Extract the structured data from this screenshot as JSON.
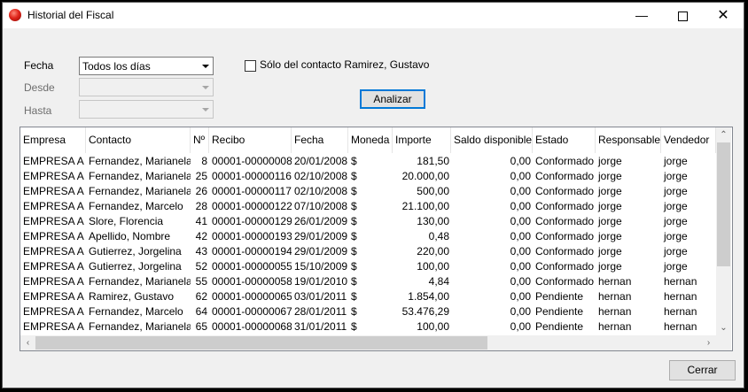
{
  "window": {
    "title": "Historial del Fiscal"
  },
  "filters": {
    "fecha_label": "Fecha",
    "fecha_value": "Todos los días",
    "desde_label": "Desde",
    "hasta_label": "Hasta",
    "contact_checkbox_label": "Sólo del contacto Ramirez, Gustavo",
    "contact_checkbox_checked": false
  },
  "buttons": {
    "analizar": "Analizar",
    "cerrar": "Cerrar"
  },
  "table": {
    "columns": [
      "Empresa",
      "Contacto",
      "Nº",
      "Recibo",
      "Fecha",
      "Moneda",
      "Importe",
      "Saldo disponible",
      "Estado",
      "Responsable",
      "Vendedor"
    ],
    "rows": [
      [
        "EMPRESA A",
        "Fernandez, Marianela",
        "8",
        "00001-00000008",
        "20/01/2008",
        "$",
        "181,50",
        "0,00",
        "Conformado",
        "jorge",
        "jorge"
      ],
      [
        "EMPRESA A",
        "Fernandez, Marianela",
        "25",
        "00001-00000116",
        "02/10/2008",
        "$",
        "20.000,00",
        "0,00",
        "Conformado",
        "jorge",
        "jorge"
      ],
      [
        "EMPRESA A",
        "Fernandez, Marianela",
        "26",
        "00001-00000117",
        "02/10/2008",
        "$",
        "500,00",
        "0,00",
        "Conformado",
        "jorge",
        "jorge"
      ],
      [
        "EMPRESA A",
        "Fernandez, Marcelo",
        "28",
        "00001-00000122",
        "07/10/2008",
        "$",
        "21.100,00",
        "0,00",
        "Conformado",
        "jorge",
        "jorge"
      ],
      [
        "EMPRESA A",
        "Slore, Florencia",
        "41",
        "00001-00000129",
        "26/01/2009",
        "$",
        "130,00",
        "0,00",
        "Conformado",
        "jorge",
        "jorge"
      ],
      [
        "EMPRESA A",
        "Apellido, Nombre",
        "42",
        "00001-00000193",
        "29/01/2009",
        "$",
        "0,48",
        "0,00",
        "Conformado",
        "jorge",
        "jorge"
      ],
      [
        "EMPRESA A",
        "Gutierrez, Jorgelina",
        "43",
        "00001-00000194",
        "29/01/2009",
        "$",
        "220,00",
        "0,00",
        "Conformado",
        "jorge",
        "jorge"
      ],
      [
        "EMPRESA A",
        "Gutierrez, Jorgelina",
        "52",
        "00001-00000055",
        "15/10/2009",
        "$",
        "100,00",
        "0,00",
        "Conformado",
        "jorge",
        "jorge"
      ],
      [
        "EMPRESA A",
        "Fernandez, Marianela",
        "55",
        "00001-00000058",
        "19/01/2010",
        "$",
        "4,84",
        "0,00",
        "Conformado",
        "hernan",
        "hernan"
      ],
      [
        "EMPRESA A",
        "Ramirez, Gustavo",
        "62",
        "00001-00000065",
        "03/01/2011",
        "$",
        "1.854,00",
        "0,00",
        "Pendiente",
        "hernan",
        "hernan"
      ],
      [
        "EMPRESA A",
        "Fernandez, Marcelo",
        "64",
        "00001-00000067",
        "28/01/2011",
        "$",
        "53.476,29",
        "0,00",
        "Pendiente",
        "hernan",
        "hernan"
      ],
      [
        "EMPRESA A",
        "Fernandez, Marianela",
        "65",
        "00001-00000068",
        "31/01/2011",
        "$",
        "100,00",
        "0,00",
        "Pendiente",
        "hernan",
        "hernan"
      ]
    ]
  },
  "colors": {
    "focus_border": "#0078d7",
    "grid_border": "#828790",
    "window_bg": "#f0f0f0"
  },
  "icons": {
    "app": "red-ball-icon",
    "minimize": "minimize-icon",
    "maximize": "maximize-icon",
    "close": "close-icon"
  }
}
